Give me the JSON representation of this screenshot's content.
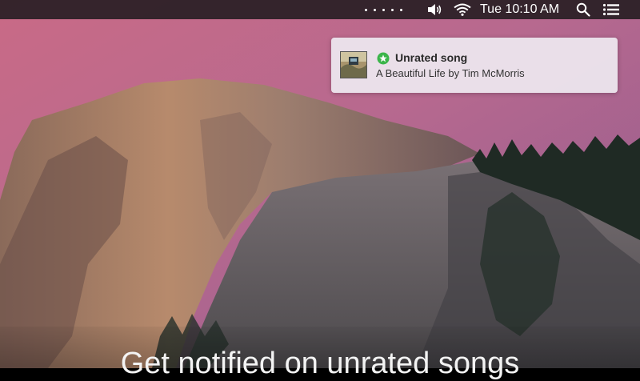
{
  "menubar": {
    "clock": "Tue 10:10 AM",
    "status_dots": 5,
    "icons": [
      "volume-icon",
      "wifi-icon",
      "spotlight-search-icon",
      "notification-center-icon"
    ]
  },
  "notification": {
    "title": "Unrated song",
    "subtitle": "A Beautiful Life by Tim McMorris",
    "status_icon": "star-badge-icon",
    "status_color": "#3bb54a"
  },
  "caption": "Get notified on unrated songs"
}
